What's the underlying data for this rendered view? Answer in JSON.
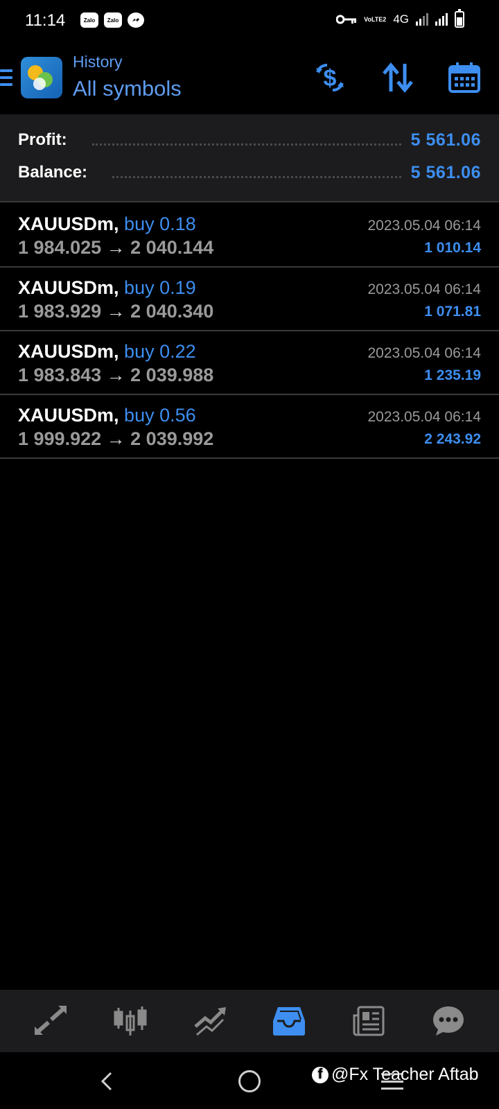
{
  "status_bar": {
    "time": "11:14",
    "apps": [
      "Zalo",
      "Zalo",
      "messenger"
    ],
    "volte": "VoLTE2",
    "network": "4G"
  },
  "header": {
    "subtitle": "History",
    "title": "All symbols",
    "icons": [
      "menu-icon",
      "metatrader-logo",
      "currency-exchange-icon",
      "sort-icon",
      "calendar-icon"
    ]
  },
  "summary": {
    "profit_label": "Profit:",
    "profit_value": "5 561.06",
    "balance_label": "Balance:",
    "balance_value": "5 561.06"
  },
  "trades": [
    {
      "symbol": "XAUUSDm,",
      "side": "buy 0.18",
      "open": "1 984.025",
      "arrow": "→",
      "close": "2 040.144",
      "time": "2023.05.04 06:14",
      "profit": "1 010.14"
    },
    {
      "symbol": "XAUUSDm,",
      "side": "buy 0.19",
      "open": "1 983.929",
      "arrow": "→",
      "close": "2 040.340",
      "time": "2023.05.04 06:14",
      "profit": "1 071.81"
    },
    {
      "symbol": "XAUUSDm,",
      "side": "buy 0.22",
      "open": "1 983.843",
      "arrow": "→",
      "close": "2 039.988",
      "time": "2023.05.04 06:14",
      "profit": "1 235.19"
    },
    {
      "symbol": "XAUUSDm,",
      "side": "buy 0.56",
      "open": "1 999.922",
      "arrow": "→",
      "close": "2 039.992",
      "time": "2023.05.04 06:14",
      "profit": "2 243.92"
    }
  ],
  "bottom_nav": {
    "items": [
      "quotes-icon",
      "chart-icon",
      "trade-icon",
      "history-icon",
      "news-icon",
      "chat-icon"
    ],
    "active": "history-icon"
  },
  "watermark": {
    "text": "@Fx Teacher Aftab"
  },
  "colors": {
    "accent": "#3d8ef0",
    "header_text": "#5e9cf0",
    "muted": "#9a9a9a",
    "panel": "#1c1c1e"
  }
}
